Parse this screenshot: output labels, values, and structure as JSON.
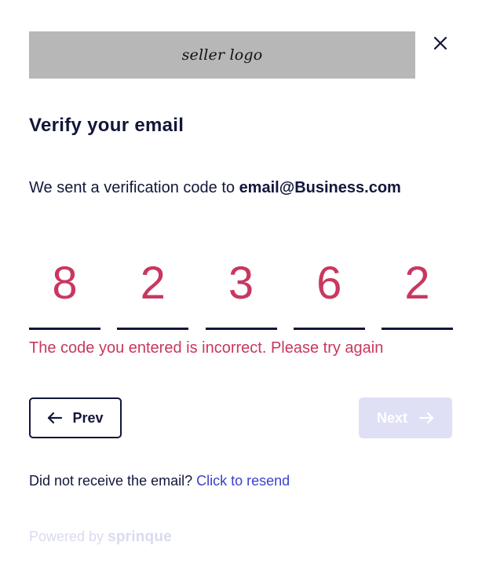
{
  "header": {
    "logo_text": "seller logo",
    "close_icon": "close-icon"
  },
  "title": "Verify your email",
  "subtitle": {
    "prefix": "We sent a verification code to ",
    "email": "email@Business.com"
  },
  "code": {
    "digits": [
      "8",
      "2",
      "3",
      "6",
      "2"
    ]
  },
  "error_message": "The code you entered is incorrect. Please try again",
  "buttons": {
    "prev_label": "Prev",
    "prev_icon": "arrow-left-icon",
    "next_label": "Next",
    "next_icon": "arrow-right-icon",
    "next_disabled": true
  },
  "resend": {
    "prompt": "Did not receive the email? ",
    "link": "Click to resend"
  },
  "footer": {
    "powered_by": "Powered by ",
    "brand": "sprinque"
  },
  "colors": {
    "text_dark": "#12163a",
    "error": "#c9375f",
    "link": "#3b3fd1",
    "disabled_button": "#dfe0f5",
    "logo_placeholder": "#b7b7b7",
    "footer_muted": "#d9dbef"
  }
}
